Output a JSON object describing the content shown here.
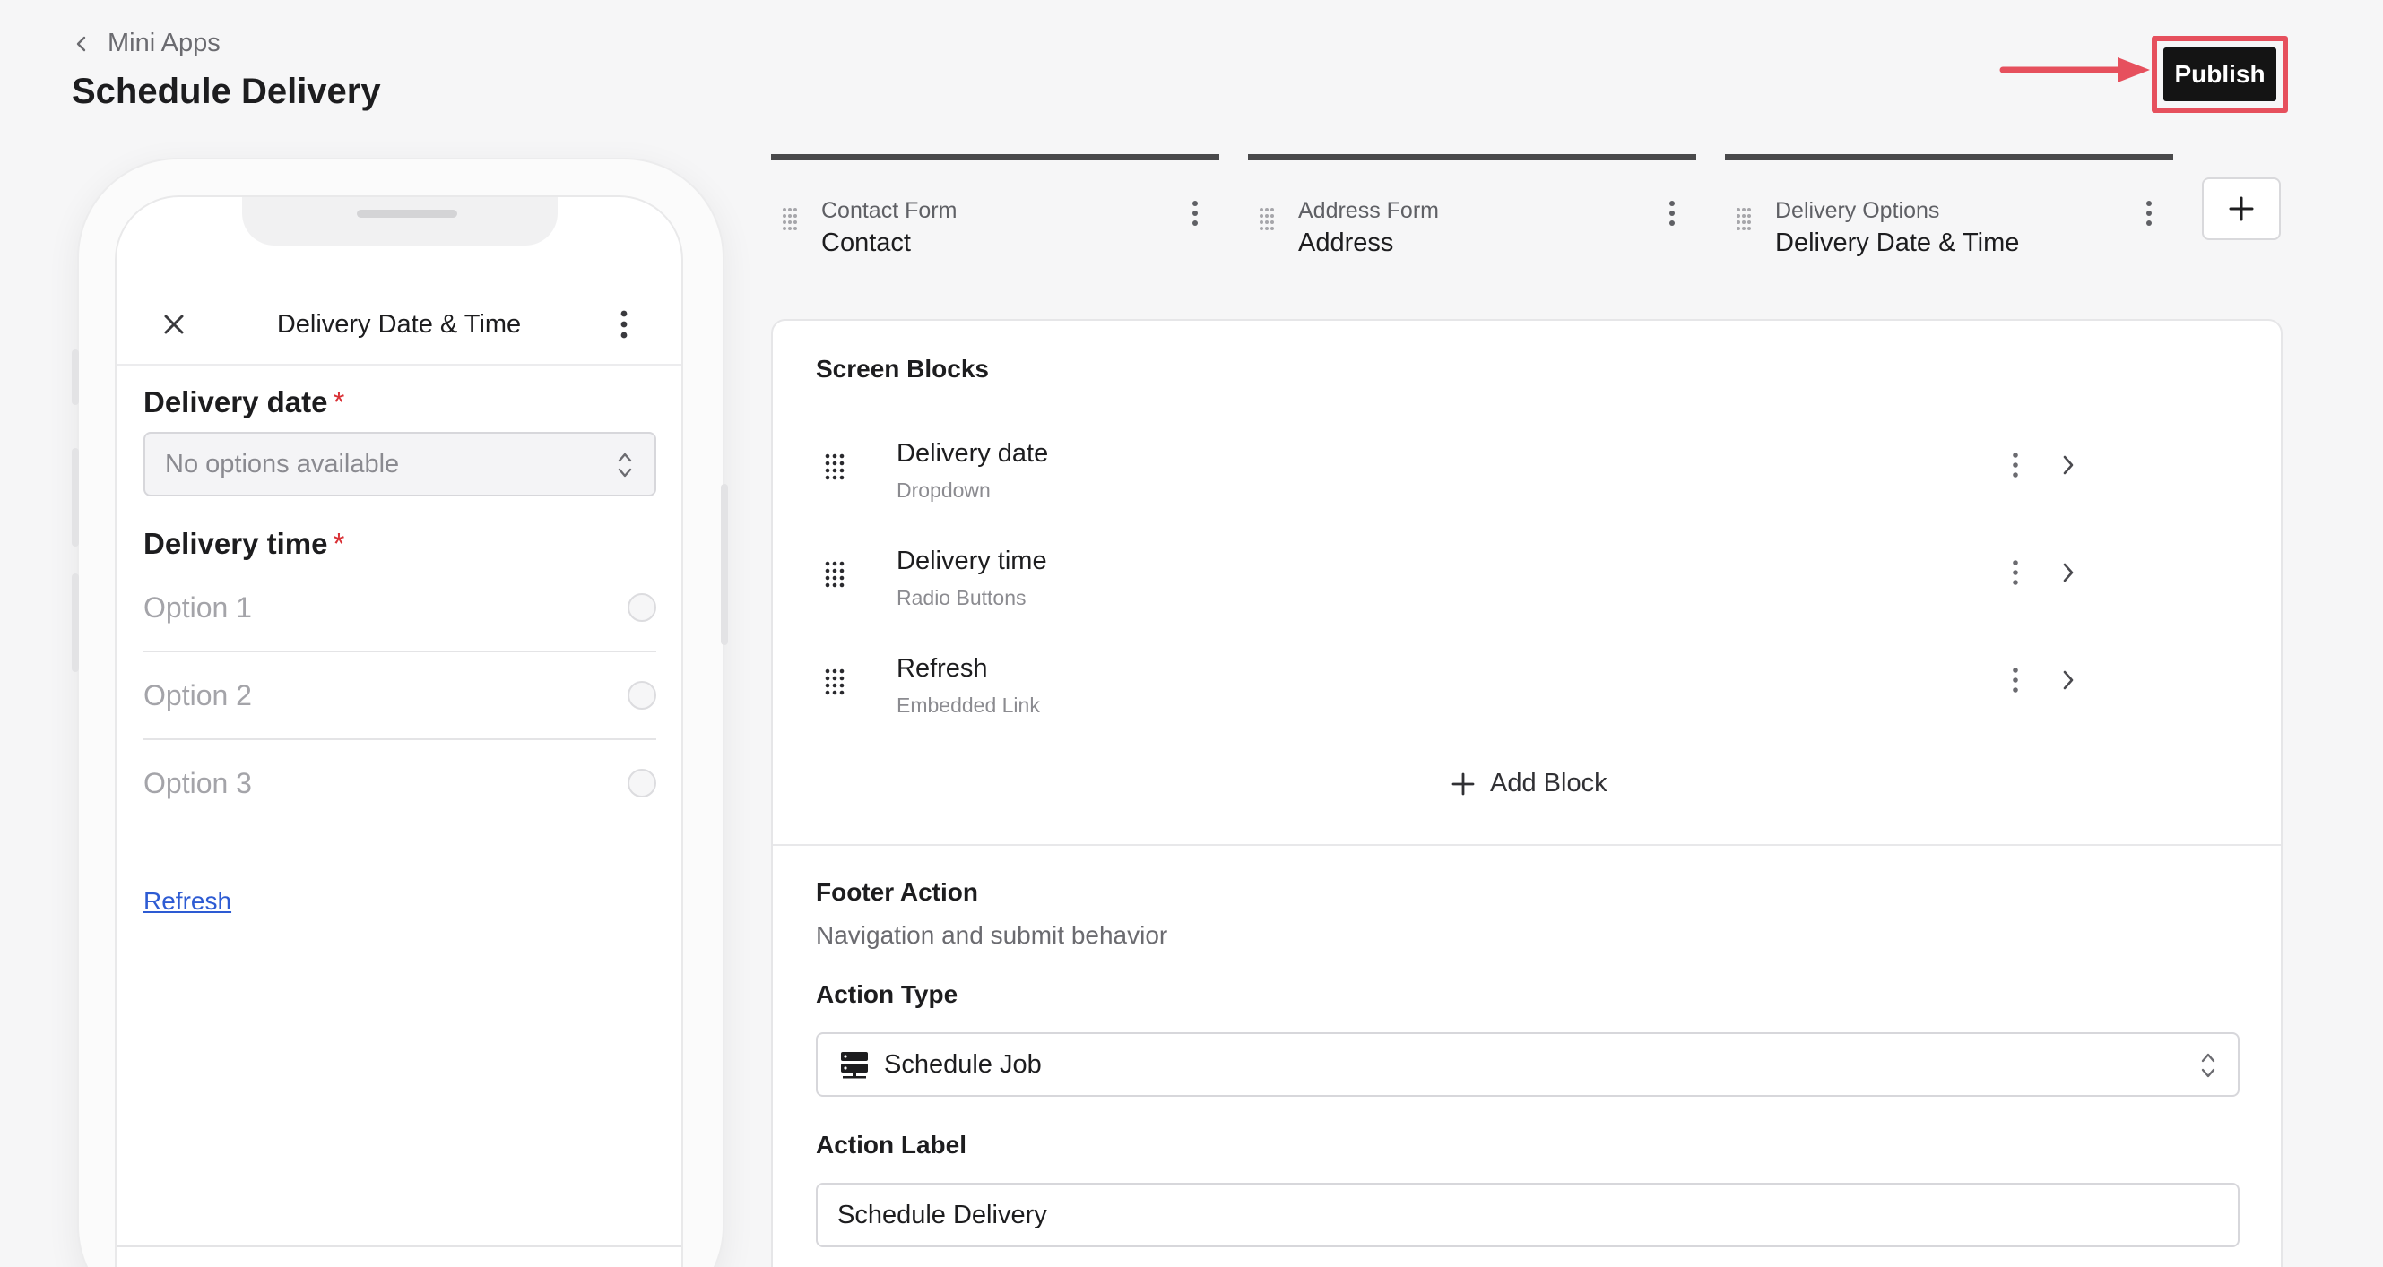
{
  "header": {
    "breadcrumb": "Mini Apps",
    "title": "Schedule Delivery",
    "publish_label": "Publish"
  },
  "phone": {
    "screen_title": "Delivery Date & Time",
    "delivery_date_label": "Delivery date",
    "required_mark": "*",
    "delivery_date_placeholder": "No options available",
    "delivery_time_label": "Delivery time",
    "options": [
      "Option 1",
      "Option 2",
      "Option 3"
    ],
    "refresh_link": "Refresh"
  },
  "tabs": [
    {
      "subtitle": "Contact Form",
      "title": "Contact"
    },
    {
      "subtitle": "Address Form",
      "title": "Address"
    },
    {
      "subtitle": "Delivery Options",
      "title": "Delivery Date & Time"
    }
  ],
  "panel": {
    "screen_blocks_title": "Screen Blocks",
    "blocks": [
      {
        "title": "Delivery date",
        "type": "Dropdown"
      },
      {
        "title": "Delivery time",
        "type": "Radio Buttons"
      },
      {
        "title": "Refresh",
        "type": "Embedded Link"
      }
    ],
    "add_block_label": "Add Block",
    "footer_title": "Footer Action",
    "footer_description": "Navigation and submit behavior",
    "action_type_label": "Action Type",
    "action_type_value": "Schedule Job",
    "action_label_label": "Action Label",
    "action_label_value": "Schedule Delivery"
  },
  "colors": {
    "highlight": "#e6505d",
    "publish_bg": "#141414",
    "link": "#2d5bd3",
    "required": "#d93035"
  }
}
